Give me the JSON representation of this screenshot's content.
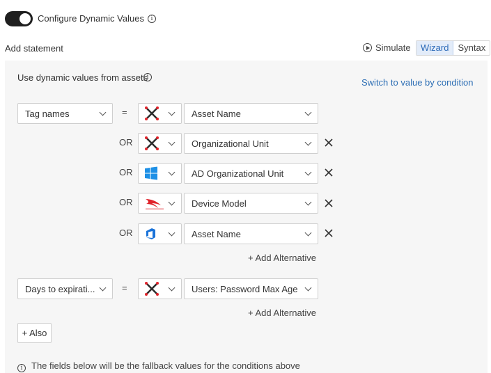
{
  "header": {
    "toggle_on": true,
    "configure_label": "Configure Dynamic Values",
    "add_statement_label": "Add statement",
    "simulate_label": "Simulate",
    "mode_tabs": [
      "Wizard",
      "Syntax"
    ],
    "active_mode": "Wizard"
  },
  "panel": {
    "dynamic_label": "Use dynamic values from assets",
    "switch_link": "Switch to value by condition",
    "statements": [
      {
        "field": "Tag names",
        "operator": "=",
        "values": [
          {
            "connector": "",
            "source_icon": "cross-x-icon",
            "value": "Asset Name",
            "removable": false
          },
          {
            "connector": "OR",
            "source_icon": "cross-x-icon",
            "value": "Organizational Unit",
            "removable": true
          },
          {
            "connector": "OR",
            "source_icon": "windows-icon",
            "value": "AD Organizational Unit",
            "removable": true
          },
          {
            "connector": "OR",
            "source_icon": "crowdstrike-icon",
            "value": "Device Model",
            "removable": true
          },
          {
            "connector": "OR",
            "source_icon": "azure-devops-icon",
            "value": "Asset Name",
            "removable": true
          }
        ],
        "add_alternative": "+ Add Alternative"
      },
      {
        "field": "Days to expirati...",
        "operator": "=",
        "values": [
          {
            "connector": "",
            "source_icon": "cross-x-icon",
            "value": "Users: Password Max Age",
            "removable": false
          }
        ],
        "add_alternative": "+ Add Alternative"
      }
    ],
    "also_button": "+ Also",
    "fallback_note": "The fields below will be the fallback values for the conditions above"
  },
  "colors": {
    "link": "#2e6fb5",
    "active_tab_bg": "#e3ecf9",
    "panel_bg": "#f6f6f6",
    "toggle_bg": "#1f1f1f",
    "windows_blue": "#1e90e6",
    "crowdstrike_red": "#e0232b"
  }
}
